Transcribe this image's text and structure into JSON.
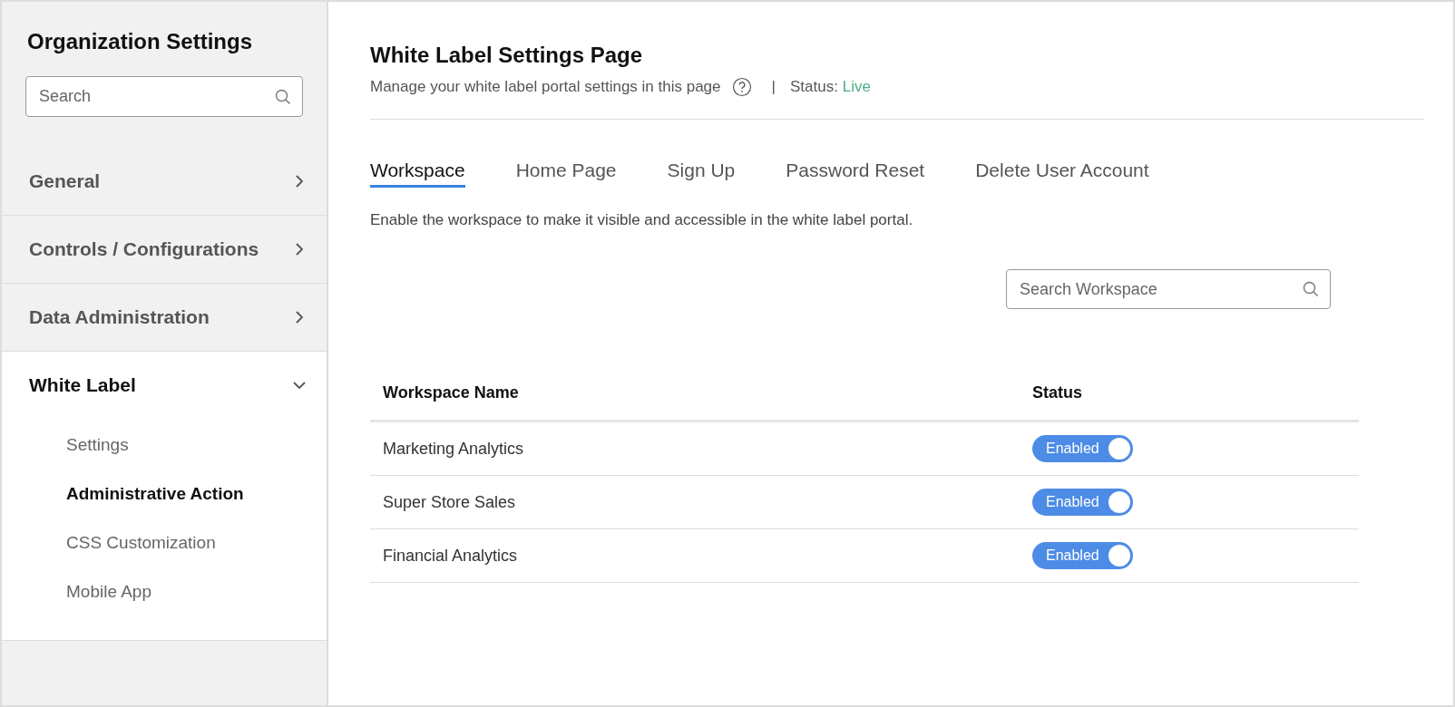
{
  "sidebar": {
    "title": "Organization Settings",
    "search": {
      "placeholder": "Search"
    },
    "items": [
      {
        "label": "General",
        "expanded": false
      },
      {
        "label": "Controls / Configurations",
        "expanded": false
      },
      {
        "label": "Data Administration",
        "expanded": false
      },
      {
        "label": "White Label",
        "expanded": true,
        "children": [
          {
            "label": "Settings",
            "selected": false
          },
          {
            "label": "Administrative Action",
            "selected": true
          },
          {
            "label": "CSS Customization",
            "selected": false
          },
          {
            "label": "Mobile App",
            "selected": false
          }
        ]
      }
    ]
  },
  "page": {
    "title": "White Label Settings Page",
    "subtitle": "Manage your white label portal settings in this page",
    "separator": "|",
    "status_label": "Status:",
    "status_value": "Live"
  },
  "tabs": [
    {
      "label": "Workspace",
      "selected": true
    },
    {
      "label": "Home Page",
      "selected": false
    },
    {
      "label": "Sign Up",
      "selected": false
    },
    {
      "label": "Password Reset",
      "selected": false
    },
    {
      "label": "Delete User Account",
      "selected": false
    }
  ],
  "description": "Enable the workspace to make it visible and accessible in the white label portal.",
  "workspace_search": {
    "placeholder": "Search Workspace"
  },
  "table": {
    "columns": [
      "Workspace Name",
      "Status"
    ],
    "rows": [
      {
        "name": "Marketing Analytics",
        "status": "Enabled",
        "on": true
      },
      {
        "name": "Super Store Sales",
        "status": "Enabled",
        "on": true
      },
      {
        "name": "Financial Analytics",
        "status": "Enabled",
        "on": true
      }
    ]
  }
}
